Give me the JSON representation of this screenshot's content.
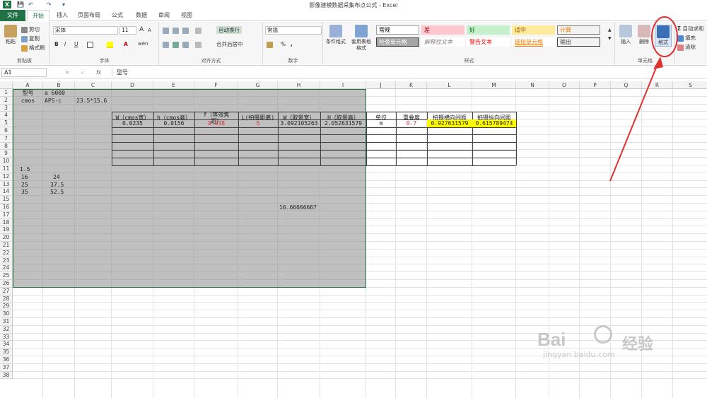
{
  "window": {
    "title": "影像建模数据采集布点公式 - Excel"
  },
  "qat": {
    "save": "💾",
    "undo": "↶",
    "redo": "↷",
    "more": "▾",
    "excel": "X"
  },
  "menu": {
    "file": "文件",
    "tabs": [
      "开始",
      "插入",
      "页面布局",
      "公式",
      "数据",
      "审阅",
      "视图"
    ],
    "active": "开始"
  },
  "ribbon": {
    "clipboard": {
      "label": "剪贴板",
      "paste": "粘贴",
      "cut": "剪切",
      "copy": "复制",
      "painter": "格式刷"
    },
    "font": {
      "label": "字体",
      "name": "宋体",
      "size": "11",
      "bold": "B",
      "italic": "I",
      "underline": "U",
      "grow": "A",
      "shrink": "A",
      "wen": "wén"
    },
    "align": {
      "label": "对齐方式",
      "wrap": "自动换行",
      "merge": "合并后居中"
    },
    "number": {
      "label": "数字",
      "format": "常规",
      "pct": "%",
      "comma": ","
    },
    "styles": {
      "label": "样式",
      "cond": "条件格式",
      "table": "套用表格格式",
      "items": [
        {
          "text": "常规",
          "color": "#000000",
          "bg": "#ffffff",
          "border": "#a0a0a0"
        },
        {
          "text": "差",
          "color": "#9c0006",
          "bg": "#ffc7ce",
          "border": "#ffc7ce"
        },
        {
          "text": "好",
          "color": "#006100",
          "bg": "#c6efce",
          "border": "#c6efce"
        },
        {
          "text": "适中",
          "color": "#9c5700",
          "bg": "#ffeb9c",
          "border": "#ffeb9c"
        },
        {
          "text": "计算",
          "color": "#fa7d00",
          "bg": "#f2f2f2",
          "border": "#7f7f7f"
        },
        {
          "text": "检查单元格",
          "color": "#ffffff",
          "bg": "#a5a5a5",
          "border": "#3f3f3f"
        },
        {
          "text": "解释性文本",
          "color": "#7f7f7f",
          "bg": "#ffffff",
          "border": "#ffffff"
        },
        {
          "text": "警告文本",
          "color": "#ff0000",
          "bg": "#ffffff",
          "border": "#ffffff"
        },
        {
          "text": "链接单元格",
          "color": "#fa7d00",
          "bg": "#ffffff",
          "border": "#ffffff"
        },
        {
          "text": "输出",
          "color": "#3f3f3f",
          "bg": "#f2f2f2",
          "border": "#3f3f3f"
        }
      ]
    },
    "cells": {
      "label": "单元格",
      "insert": "插入",
      "delete": "删除",
      "format": "格式"
    },
    "edit": {
      "autosum": "自动求和",
      "fill": "填充",
      "clear": "清除"
    }
  },
  "formula": {
    "namebox": "A1",
    "fx": "fx",
    "value": "型号",
    "cancel": "✕",
    "enter": "✓"
  },
  "columns": [
    "A",
    "B",
    "C",
    "D",
    "E",
    "F",
    "G",
    "H",
    "I",
    "J",
    "K",
    "L",
    "M",
    "N",
    "O",
    "P",
    "Q",
    "R",
    "S"
  ],
  "rows": [
    "1",
    "2",
    "3",
    "4",
    "5",
    "6",
    "7",
    "8",
    "9",
    "10",
    "11",
    "12",
    "13",
    "14",
    "15",
    "16",
    "17",
    "18",
    "19",
    "20",
    "21",
    "22",
    "23",
    "24",
    "25",
    "26",
    "27",
    "28",
    "29",
    "30",
    "31",
    "32",
    "33",
    "34",
    "35",
    "36",
    "37",
    "38"
  ],
  "cells": {
    "A1": "型号",
    "B1": "a 6000",
    "A2": "cmos",
    "B2": "APS-c",
    "C2": "23.5*15.6",
    "D4": "W（cmos宽）",
    "E4": "h（cmos高）",
    "F4a": "f（等效焦",
    "F4b": "距）",
    "G4": "L(拍摄距离)",
    "H4": "W（取景宽）",
    "I4": "H（取景高）",
    "J4": "单位",
    "K4": "重叠度",
    "L4": "拍摄横向间距",
    "M4": "拍摄纵向间距",
    "D5": "0.0235",
    "E5": "0.0156",
    "F5": "0.038",
    "G5": "5",
    "H5": "3.092105263",
    "I5": "2.052631579",
    "J5": "m",
    "K5": "0.7",
    "L5": "0.927631579",
    "M5": "0.615789474",
    "A11": "1.5",
    "A12": "16",
    "B12": "24",
    "A13": "25",
    "B13": "37.5",
    "A14": "35",
    "B14": "52.5",
    "H16": "16.66666667"
  },
  "watermark": {
    "brand": "Bai",
    "brand2": "经验",
    "url": "jingyan.baidu.com"
  },
  "colors": {
    "accent": "#217346",
    "highlight": "#ffff00",
    "red": "#e03030"
  }
}
